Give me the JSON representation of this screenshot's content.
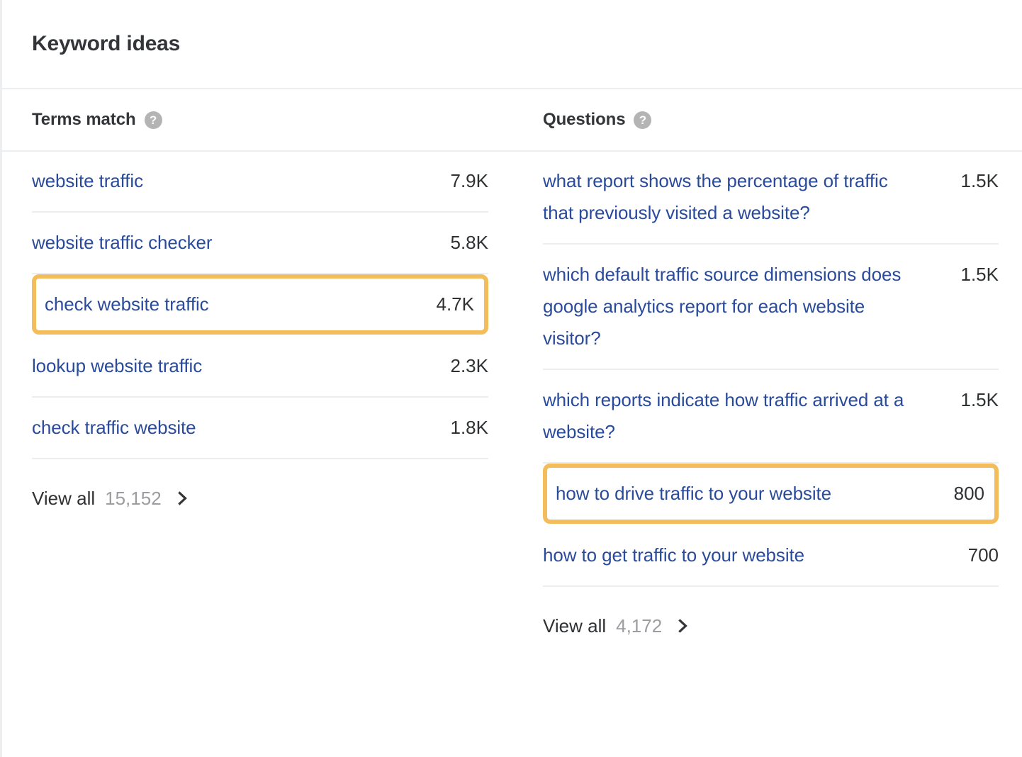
{
  "card": {
    "title": "Keyword ideas"
  },
  "colors": {
    "link": "#2a4b9b",
    "highlight": "#f3bd5c",
    "text": "#2f3133",
    "muted": "#9b9da0",
    "divider": "#ededee"
  },
  "icons": {
    "help": "?",
    "chevron_right": "chevron-right-icon"
  },
  "terms_match": {
    "heading": "Terms match",
    "help_tooltip_icon": "help-circle-icon",
    "rows": [
      {
        "keyword": "website traffic",
        "volume": "7.9K",
        "highlighted": false
      },
      {
        "keyword": "website traffic checker",
        "volume": "5.8K",
        "highlighted": false
      },
      {
        "keyword": "check website traffic",
        "volume": "4.7K",
        "highlighted": true
      },
      {
        "keyword": "lookup website traffic",
        "volume": "2.3K",
        "highlighted": false
      },
      {
        "keyword": "check traffic website",
        "volume": "1.8K",
        "highlighted": false
      }
    ],
    "view_all": {
      "label": "View all",
      "count": "15,152"
    }
  },
  "questions": {
    "heading": "Questions",
    "help_tooltip_icon": "help-circle-icon",
    "rows": [
      {
        "keyword": "what report shows the percentage of traffic that previously visited a website?",
        "volume": "1.5K",
        "highlighted": false
      },
      {
        "keyword": "which default traffic source dimensions does google analytics report for each website visitor?",
        "volume": "1.5K",
        "highlighted": false
      },
      {
        "keyword": "which reports indicate how traffic arrived at a website?",
        "volume": "1.5K",
        "highlighted": false
      },
      {
        "keyword": "how to drive traffic to your website",
        "volume": "800",
        "highlighted": true
      },
      {
        "keyword": "how to get traffic to your website",
        "volume": "700",
        "highlighted": false
      }
    ],
    "view_all": {
      "label": "View all",
      "count": "4,172"
    }
  }
}
